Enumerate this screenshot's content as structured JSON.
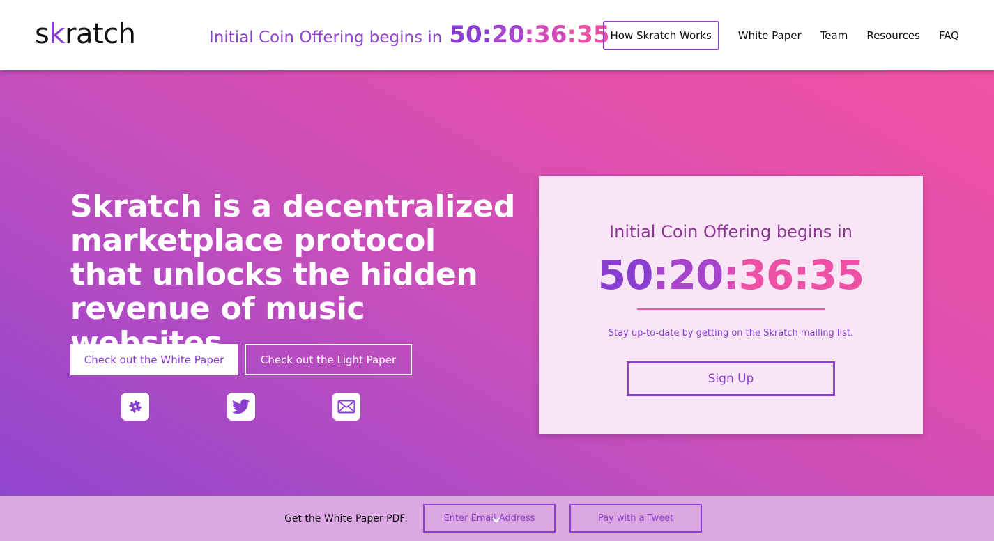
{
  "header": {
    "logo": {
      "prefix": "s",
      "k": "k",
      "suffix": "ratch"
    },
    "countdown_label": "Initial Coin Offering begins in",
    "countdown": {
      "days": "50",
      "hours": "20",
      "minutes": "36",
      "seconds": "35",
      "sep": ":"
    },
    "nav": [
      {
        "label": "How Skratch Works",
        "active": true
      },
      {
        "label": "White Paper"
      },
      {
        "label": "Team"
      },
      {
        "label": "Resources"
      },
      {
        "label": "FAQ"
      }
    ]
  },
  "hero": {
    "headline": "Skratch is a decentralized marketplace protocol that unlocks the hidden revenue of music websites.",
    "primary_button": "Check out the White Paper",
    "secondary_button": "Check out the Light Paper",
    "social": [
      {
        "icon": "slack-icon"
      },
      {
        "icon": "twitter-icon"
      },
      {
        "icon": "mail-icon"
      }
    ]
  },
  "card": {
    "label": "Initial Coin Offering begins in",
    "countdown": {
      "days": "50",
      "hours": "20",
      "minutes": "36",
      "seconds": "35",
      "sep": ":"
    },
    "subtitle": "Stay up-to-date by getting on the Skratch mailing list.",
    "button": "Sign Up"
  },
  "footer": {
    "label": "Get the White Paper PDF:",
    "email_placeholder": "Enter Email Address",
    "tweet_button": "Pay with a Tweet"
  },
  "colors": {
    "brand_purple": "#8a3fd0",
    "brand_pink": "#ec51a6",
    "card_bg": "#f8e5f5",
    "footer_bg": "#dba8e3"
  }
}
